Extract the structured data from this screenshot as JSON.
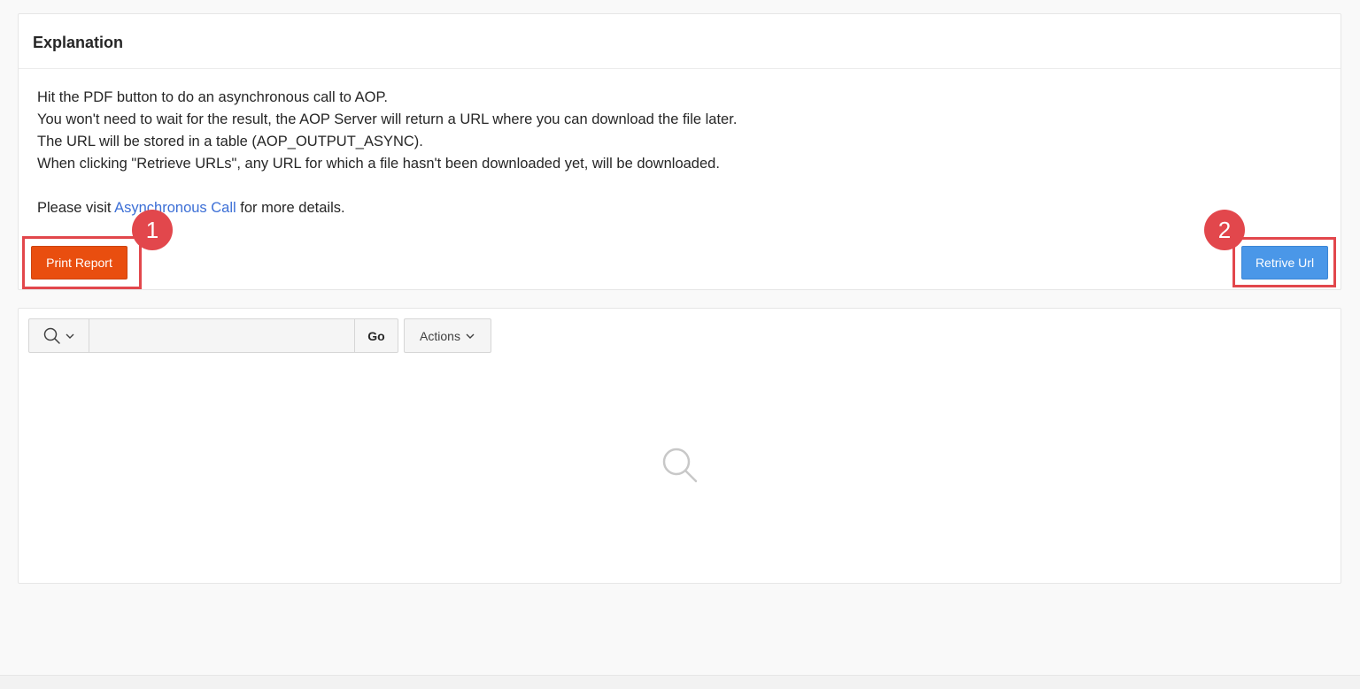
{
  "explanation": {
    "title": "Explanation",
    "lines": [
      "Hit the PDF button to do an asynchronous call to AOP.",
      "You won't need to wait for the result, the AOP Server will return a URL where you can download the file later.",
      "The URL will be stored in a table (AOP_OUTPUT_ASYNC).",
      "When clicking \"Retrieve URLs\", any URL for which a file hasn't been downloaded yet, will be downloaded."
    ],
    "visit_prefix": "Please visit ",
    "visit_link": "Asynchronous Call",
    "visit_suffix": " for more details."
  },
  "buttons": {
    "print_report": "Print Report",
    "retrieve_url": "Retrive Url"
  },
  "annotations": {
    "badge_1": "1",
    "badge_2": "2"
  },
  "report": {
    "search_value": "",
    "go_label": "Go",
    "actions_label": "Actions"
  },
  "icons": {
    "search_type": "search-icon",
    "search_chevron": "chevron-down-icon",
    "actions_chevron": "chevron-down-icon",
    "empty": "search-icon"
  },
  "colors": {
    "print_button": "#e94e0f",
    "retrieve_button": "#4a97e8",
    "annotation": "#e2474c",
    "link": "#3c6fd6"
  }
}
